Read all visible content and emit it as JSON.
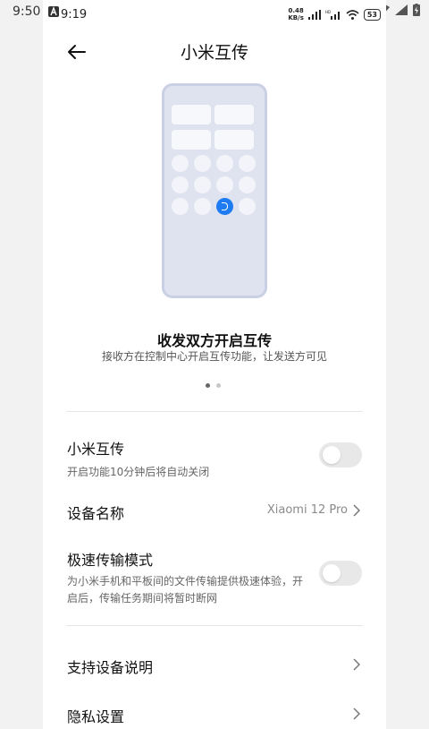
{
  "host": {
    "time": "9:50"
  },
  "status": {
    "time": "9:19",
    "speed_top": "0.48",
    "speed_bottom": "KB/s",
    "battery": "53"
  },
  "header": {
    "title": "小米互传",
    "back_icon": "arrow-left-icon"
  },
  "carousel": {
    "title": "收发双方开启互传",
    "subtitle": "接收方在控制中心开启互传功能，让发送方可见",
    "page": 1,
    "page_count": 2
  },
  "settings": {
    "xiaomi_transfer": {
      "title": "小米互传",
      "desc": "开启功能10分钟后将自动关闭",
      "enabled": false
    },
    "device_name": {
      "title": "设备名称",
      "value": "Xiaomi 12 Pro"
    },
    "speed_mode": {
      "title": "极速传输模式",
      "desc": "为小米手机和平板间的文件传输提供极速体验，开启后，传输任务期间将暂时断网",
      "enabled": false
    },
    "supported_devices": {
      "title": "支持设备说明"
    },
    "privacy": {
      "title": "隐私设置"
    }
  },
  "colors": {
    "accent": "#1e7bf2",
    "toggle_off": "#e8e8e8",
    "illustration": "#dfe3f0"
  }
}
